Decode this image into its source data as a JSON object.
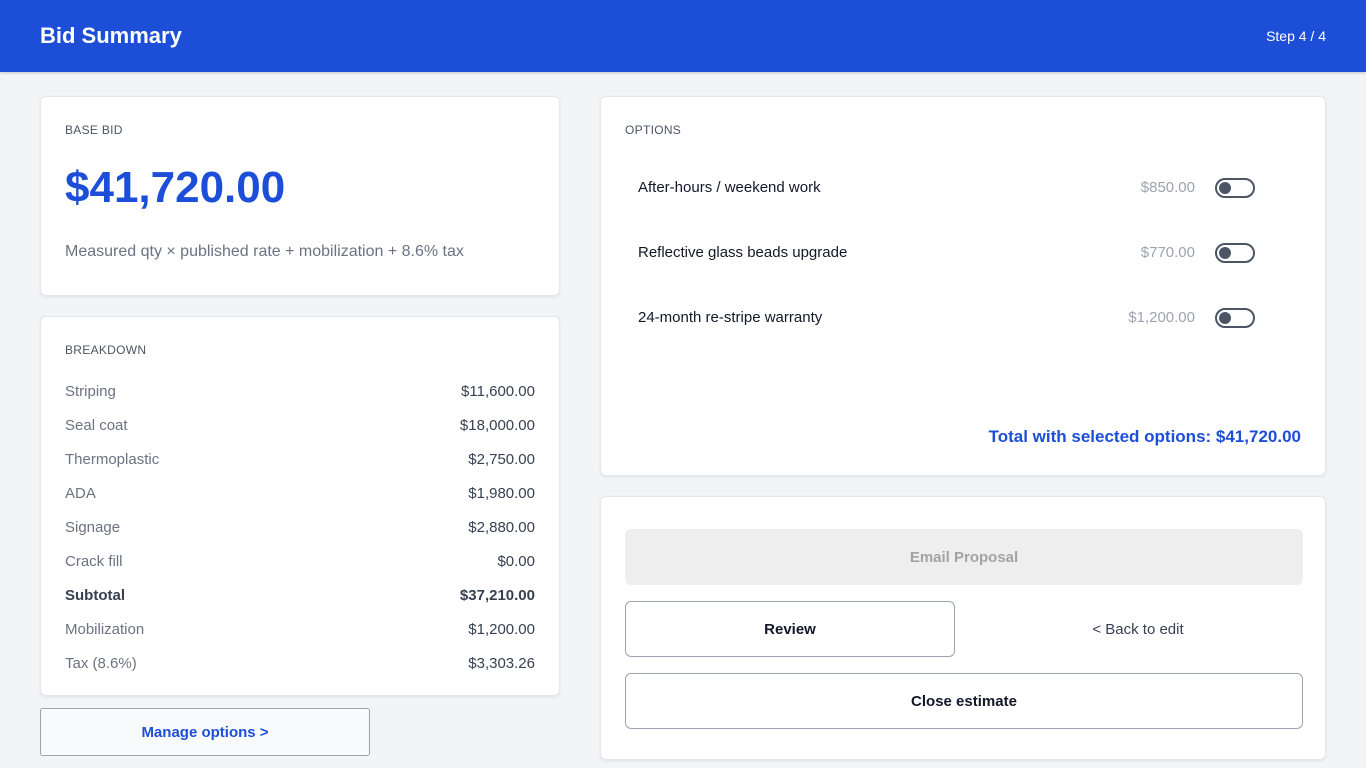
{
  "header": {
    "title": "Bid Summary",
    "step": "Step 4 / 4"
  },
  "base_bid": {
    "label": "BASE BID",
    "amount": "$41,720.00",
    "description": "Measured qty × published rate + mobilization + 8.6% tax"
  },
  "breakdown": {
    "label": "BREAKDOWN",
    "rows": [
      {
        "label": "Striping",
        "value": "$11,600.00"
      },
      {
        "label": "Seal coat",
        "value": "$18,000.00"
      },
      {
        "label": "Thermoplastic",
        "value": "$2,750.00"
      },
      {
        "label": "ADA",
        "value": "$1,980.00"
      },
      {
        "label": "Signage",
        "value": "$2,880.00"
      },
      {
        "label": "Crack fill",
        "value": "$0.00"
      },
      {
        "label": "Subtotal",
        "value": "$37,210.00"
      },
      {
        "label": "Mobilization",
        "value": "$1,200.00"
      },
      {
        "label": "Tax (8.6%)",
        "value": "$3,303.26"
      }
    ]
  },
  "options": {
    "label": "OPTIONS",
    "items": [
      {
        "label": "After-hours / weekend work",
        "price": "$850.00",
        "enabled": false
      },
      {
        "label": "Reflective glass beads upgrade",
        "price": "$770.00",
        "enabled": false
      },
      {
        "label": "24-month re-stripe warranty",
        "price": "$1,200.00",
        "enabled": false
      }
    ],
    "total": "Total with selected options: $41,720.00"
  },
  "actions": {
    "email": "Email Proposal",
    "review": "Review",
    "back": "< Back to edit",
    "close": "Close estimate"
  },
  "manage_options": "Manage options >",
  "colors": {
    "primary": "#1d4ed8",
    "background": "#f3f4f6"
  }
}
